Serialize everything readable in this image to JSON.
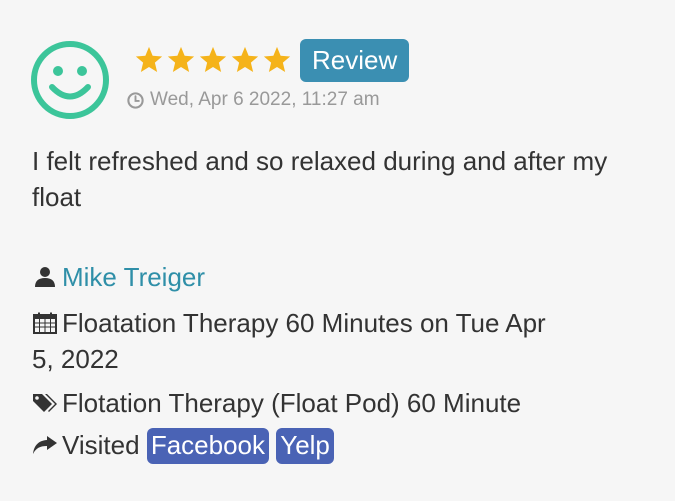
{
  "review": {
    "avatar_icon": "smiley-face-icon",
    "rating": 5,
    "rating_max": 5,
    "star_color": "#f5b31a",
    "badge_label": "Review",
    "badge_color": "#3b8fb2",
    "date": "Wed, Apr 6 2022, 11:27 am",
    "comment": "I felt refreshed and so relaxed during and after my float",
    "author": "Mike Treiger",
    "author_link_color": "#2f8fa8",
    "appointment_line1": "Floatation Therapy 60 Minutes on Tue Apr",
    "appointment_line2": "5, 2022",
    "service": "Flotation Therapy (Float Pod) 60 Minute",
    "visited_label": "Visited",
    "sources": [
      {
        "label": "Facebook",
        "color": "#4a63b5"
      },
      {
        "label": "Yelp",
        "color": "#4a63b5"
      }
    ],
    "icons": {
      "date": "clock-icon",
      "author": "user-icon",
      "appointment": "calendar-icon",
      "service": "tag-icon",
      "visited": "share-arrow-icon"
    },
    "avatar_color": "#3cc59a"
  }
}
